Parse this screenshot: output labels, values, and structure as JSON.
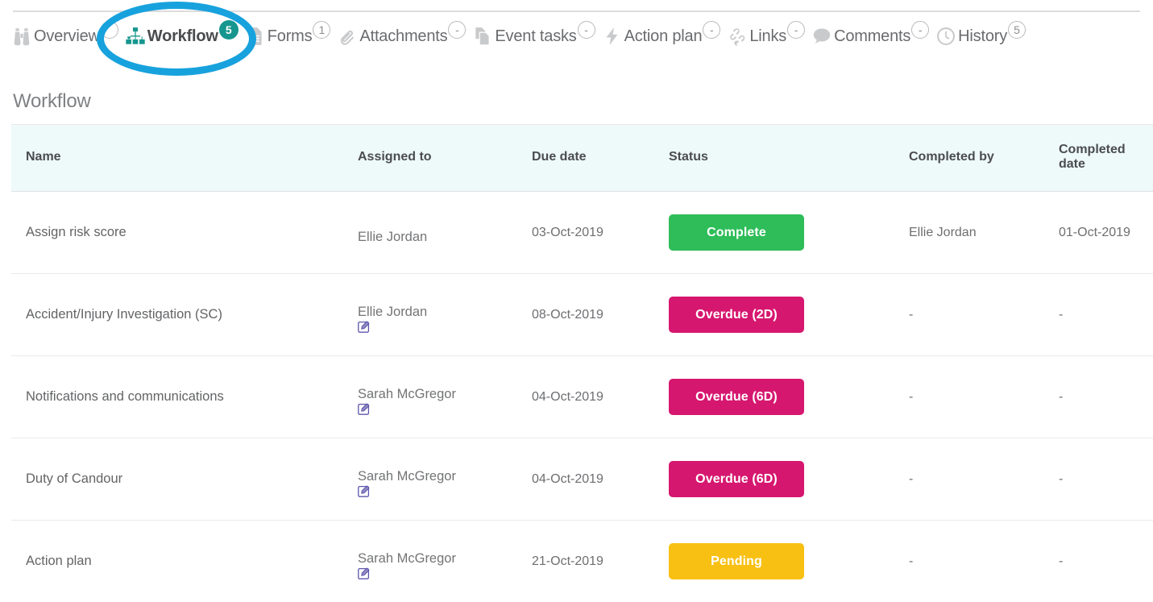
{
  "tabs": [
    {
      "label": "Overview",
      "icon": "binoculars-icon",
      "badge": "",
      "active": false
    },
    {
      "label": "Workflow",
      "icon": "sitemap-icon",
      "badge": "5",
      "active": true
    },
    {
      "label": "Forms",
      "icon": "document-icon",
      "badge": "1",
      "active": false
    },
    {
      "label": "Attachments",
      "icon": "paperclip-icon",
      "badge": "-",
      "active": false
    },
    {
      "label": "Event tasks",
      "icon": "copy-pages-icon",
      "badge": "-",
      "active": false
    },
    {
      "label": "Action plan",
      "icon": "lightning-icon",
      "badge": "-",
      "active": false
    },
    {
      "label": "Links",
      "icon": "chain-link-icon",
      "badge": "-",
      "active": false
    },
    {
      "label": "Comments",
      "icon": "speech-bubble-icon",
      "badge": "-",
      "active": false
    },
    {
      "label": "History",
      "icon": "clock-icon",
      "badge": "5",
      "active": false
    }
  ],
  "section": {
    "title": "Workflow"
  },
  "table": {
    "columns": [
      "Name",
      "Assigned to",
      "Due date",
      "Status",
      "Completed by",
      "Completed date"
    ],
    "rows": [
      {
        "name": "Assign risk score",
        "assigned_to": "Ellie Jordan",
        "editable": false,
        "due_date": "03-Oct-2019",
        "status": "Complete",
        "status_type": "complete",
        "completed_by": "Ellie Jordan",
        "completed_date": "01-Oct-2019"
      },
      {
        "name": "Accident/Injury Investigation (SC)",
        "assigned_to": "Ellie Jordan",
        "editable": true,
        "due_date": "08-Oct-2019",
        "status": "Overdue (2D)",
        "status_type": "overdue",
        "completed_by": "-",
        "completed_date": "-"
      },
      {
        "name": "Notifications and communications",
        "assigned_to": "Sarah McGregor",
        "editable": true,
        "due_date": "04-Oct-2019",
        "status": "Overdue (6D)",
        "status_type": "overdue",
        "completed_by": "-",
        "completed_date": "-"
      },
      {
        "name": "Duty of Candour",
        "assigned_to": "Sarah McGregor",
        "editable": true,
        "due_date": "04-Oct-2019",
        "status": "Overdue (6D)",
        "status_type": "overdue",
        "completed_by": "-",
        "completed_date": "-"
      },
      {
        "name": "Action plan",
        "assigned_to": "Sarah McGregor",
        "editable": true,
        "due_date": "21-Oct-2019",
        "status": "Pending",
        "status_type": "pending",
        "completed_by": "-",
        "completed_date": "-"
      }
    ]
  },
  "annotation": {
    "shape": "ellipse-highlight",
    "color": "#17a2dd",
    "target": "Workflow"
  },
  "colors": {
    "complete": "#2ebd59",
    "overdue": "#d6176f",
    "pending": "#f8c013",
    "active_tab_icon": "#17968f",
    "badge_filled": "#17968f",
    "edit_icon": "#5d56ad",
    "header_bg": "#eefafa",
    "highlight": "#17a2dd"
  }
}
